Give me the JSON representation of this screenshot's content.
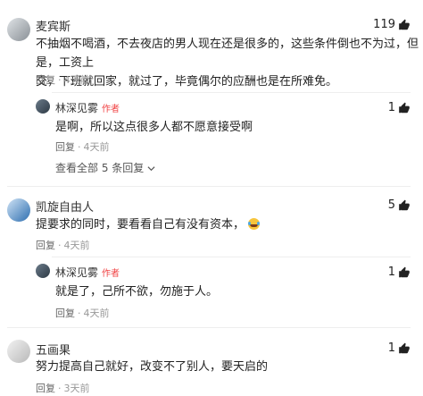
{
  "comments": [
    {
      "name": "麦宾斯",
      "text_line1": "不抽烟不喝酒，不去夜店的男人现在还是很多的，这些条件倒也不为过，但是，工资上",
      "text_line2": "交，下班就回家，就过了，毕竟偶尔的应酬也是在所难免。",
      "reply": "回复",
      "time": "4天前",
      "likes": "119"
    },
    {
      "name": "林深见雾",
      "badge": "作者",
      "text": "是啊，所以这点很多人都不愿意接受啊",
      "reply": "回复",
      "time": "4天前",
      "likes": "1",
      "more": "查看全部 5 条回复"
    },
    {
      "name": "凯旋自由人",
      "text": "提要求的同时，要看看自己有没有资本，",
      "reply": "回复",
      "time": "4天前",
      "likes": "5"
    },
    {
      "name": "林深见雾",
      "badge": "作者",
      "text": "就是了，己所不欲，勿施于人。",
      "reply": "回复",
      "time": "4天前",
      "likes": "1"
    },
    {
      "name": "五画果",
      "text": "努力提高自己就好，改变不了别人，要天启的",
      "reply": "回复",
      "time": "3天前",
      "likes": "1"
    }
  ],
  "icons": {
    "like": "thumbs-up-icon",
    "more_chevron": "chevron-down-icon",
    "emoji": "laughing-tears-emoji-icon"
  },
  "colors": {
    "author_badge": "#f04142",
    "meta": "#999999"
  }
}
